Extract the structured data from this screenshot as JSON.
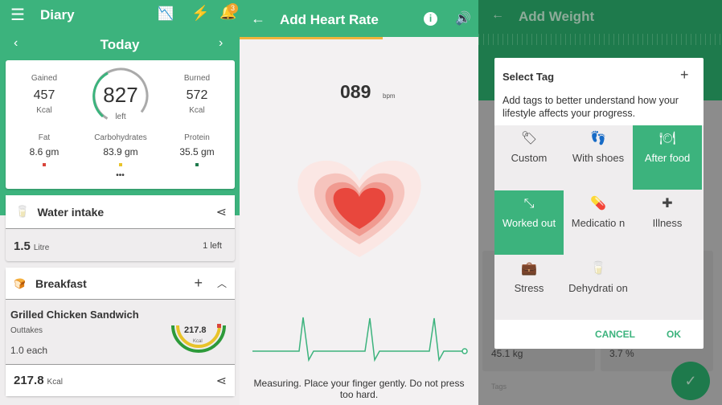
{
  "diary": {
    "title": "Diary",
    "notification_count": "3",
    "date": "Today",
    "summary": {
      "gained_label": "Gained",
      "gained": "457",
      "gained_unit": "Kcal",
      "left": "827",
      "left_label": "left",
      "burned_label": "Burned",
      "burned": "572",
      "burned_unit": "Kcal",
      "macros": [
        {
          "label": "Fat",
          "value": "8.6 gm",
          "color": "#d9453b"
        },
        {
          "label": "Carbohydrates",
          "value": "83.9 gm",
          "color": "#e8c32a"
        },
        {
          "label": "Protein",
          "value": "35.5 gm",
          "color": "#1f7a4c"
        }
      ],
      "more": "•••"
    },
    "water": {
      "title": "Water intake",
      "value": "1.5",
      "unit": "Litre",
      "left": "1 left"
    },
    "breakfast": {
      "title": "Breakfast",
      "item_name": "Grilled Chicken Sandwich",
      "item_sub": "Outtakes",
      "qty": "1.0  each",
      "item_kcal": "217.8",
      "item_kcal_unit": "Kcal",
      "total": "217.8",
      "total_unit": "Kcal"
    }
  },
  "heart": {
    "title": "Add Heart Rate",
    "bpm": "089",
    "bpm_unit": "bpm",
    "instruction": "Measuring. Place your finger gently. Do not press too hard.",
    "accent": "#3cb37d",
    "heart_color": "#e8473d"
  },
  "weight": {
    "title": "Add Weight",
    "bg_values": [
      "45.1 kg",
      "3.7 %"
    ],
    "bg_tags_label": "Tags",
    "dialog": {
      "title": "Select Tag",
      "description": "Add tags to better understand how your lifestyle affects your progress.",
      "tags": [
        {
          "label": "Custom",
          "icon": "tag-icon",
          "selected": false,
          "glyph": "🏷"
        },
        {
          "label": "With shoes",
          "icon": "footprints-icon",
          "selected": false,
          "glyph": "👣"
        },
        {
          "label": "After food",
          "icon": "cutlery-icon",
          "selected": true,
          "glyph": "🍽"
        },
        {
          "label": "Worked out",
          "icon": "dumbbell-icon",
          "selected": true,
          "glyph": "⤡"
        },
        {
          "label": "Medicatio n",
          "icon": "pill-icon",
          "selected": false,
          "glyph": "💊"
        },
        {
          "label": "Illness",
          "icon": "medical-cross-icon",
          "selected": false,
          "glyph": "✚"
        },
        {
          "label": "Stress",
          "icon": "briefcase-icon",
          "selected": false,
          "glyph": "💼"
        },
        {
          "label": "Dehydrati on",
          "icon": "cup-icon",
          "selected": false,
          "glyph": "🥛"
        }
      ],
      "cancel": "CANCEL",
      "ok": "OK"
    }
  }
}
